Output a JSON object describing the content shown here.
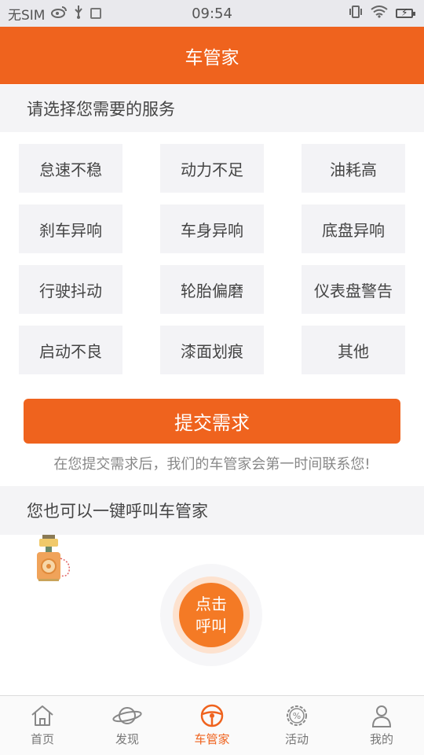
{
  "status_bar": {
    "carrier": "无SIM",
    "time": "09:54",
    "icons": [
      "weibo-icon",
      "usb-icon",
      "notification-icon",
      "vibrate-icon",
      "wifi-icon",
      "battery-charging-icon"
    ]
  },
  "header": {
    "title": "车管家"
  },
  "services": {
    "title": "请选择您需要的服务",
    "items": [
      "怠速不稳",
      "动力不足",
      "油耗高",
      "刹车异响",
      "车身异响",
      "底盘异响",
      "行驶抖动",
      "轮胎偏磨",
      "仪表盘警告",
      "启动不良",
      "漆面划痕",
      "其他"
    ]
  },
  "submit": {
    "label": "提交需求",
    "hint": "在您提交需求后，我们的车管家会第一时间联系您!"
  },
  "call": {
    "title": "您也可以一键呼叫车管家",
    "button_line1": "点击",
    "button_line2": "呼叫"
  },
  "tabbar": {
    "active": "车管家",
    "items": [
      {
        "label": "首页",
        "icon": "home-icon"
      },
      {
        "label": "发现",
        "icon": "planet-icon"
      },
      {
        "label": "车管家",
        "icon": "steering-wheel-icon"
      },
      {
        "label": "活动",
        "icon": "percent-gear-icon"
      },
      {
        "label": "我的",
        "icon": "user-icon"
      }
    ]
  },
  "colors": {
    "accent": "#ef631e",
    "call_button": "#f47a25",
    "section_bg": "#f4f4f6",
    "chip_bg": "#f3f3f6"
  }
}
